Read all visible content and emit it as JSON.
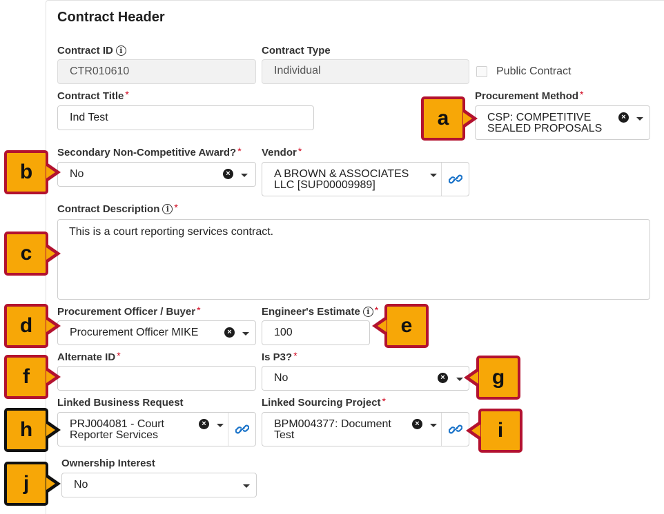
{
  "header": {
    "title": "Contract Header"
  },
  "fields": {
    "contract_id": {
      "label": "Contract ID",
      "value": "CTR010610"
    },
    "contract_type": {
      "label": "Contract Type",
      "value": "Individual"
    },
    "public_contract": {
      "label": "Public Contract"
    },
    "contract_title": {
      "label": "Contract Title",
      "value": "Ind Test"
    },
    "procurement_method": {
      "label": "Procurement Method",
      "value_line1": "CSP: COMPETITIVE",
      "value_line2": "SEALED PROPOSALS"
    },
    "secondary_award": {
      "label": "Secondary Non-Competitive Award?",
      "value": "No"
    },
    "vendor": {
      "label": "Vendor",
      "value_line1": "A BROWN & ASSOCIATES",
      "value_line2": "LLC [SUP00009989]"
    },
    "description": {
      "label": "Contract Description",
      "value": "This is a court reporting services contract."
    },
    "officer": {
      "label": "Procurement Officer / Buyer",
      "value": "Procurement Officer MIKE"
    },
    "estimate": {
      "label": "Engineer's Estimate",
      "value": "100"
    },
    "alternate_id": {
      "label": "Alternate ID",
      "value": ""
    },
    "is_p3": {
      "label": "Is P3?",
      "value": "No"
    },
    "business_request": {
      "label": "Linked Business Request",
      "value_line1": "PRJ004081 - Court",
      "value_line2": "Reporter Services"
    },
    "sourcing_project": {
      "label": "Linked Sourcing Project",
      "value_line1": "BPM004377: Document",
      "value_line2": "Test"
    },
    "ownership": {
      "label": "Ownership Interest",
      "value": "No"
    }
  },
  "markers": {
    "required": "*",
    "info": "i",
    "clear": "×"
  },
  "callouts": {
    "a": "a",
    "b": "b",
    "c": "c",
    "d": "d",
    "e": "e",
    "f": "f",
    "g": "g",
    "h": "h",
    "i": "i",
    "j": "j"
  },
  "colors": {
    "callout_fill": "#f7a707",
    "callout_border_red": "#b3122f",
    "callout_border_black": "#111111",
    "required_star": "#d0021b",
    "link_icon": "#1a73c9"
  },
  "icons": {
    "info": "info-icon",
    "clear": "clear-icon",
    "dropdown": "chevron-down-icon",
    "link": "link-icon"
  }
}
